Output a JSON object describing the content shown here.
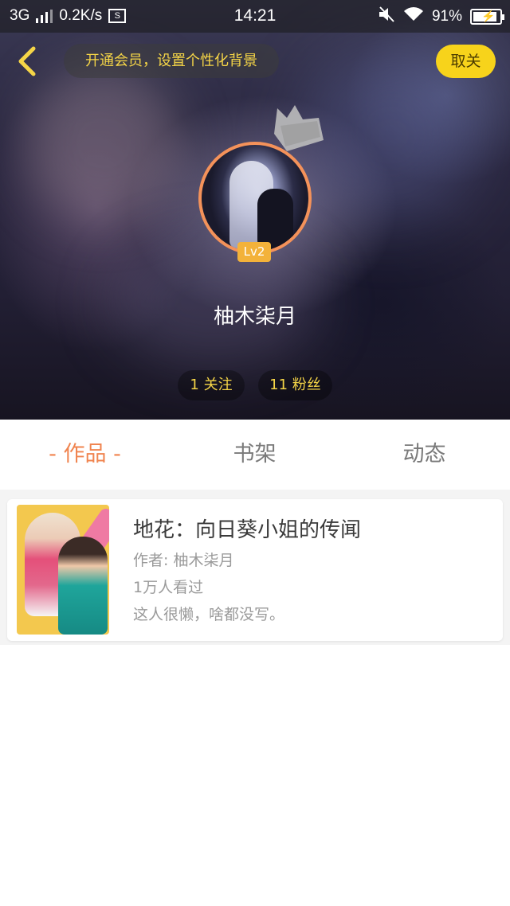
{
  "status_bar": {
    "network": "3G",
    "speed": "0.2K/s",
    "network_icon_label": "S",
    "time": "14:21",
    "battery": "91%",
    "battery_level": 0.91,
    "icons": [
      "signal-icon",
      "screenshot-icon",
      "mute-icon",
      "wifi-icon",
      "battery-icon"
    ]
  },
  "header": {
    "vip_banner": "开通会员，设置个性化背景",
    "unfollow_label": "取关",
    "level_badge": "Lv2",
    "username": "柚木柒月",
    "following": "1 关注",
    "followers": "11 粉丝",
    "accent_color": "#f7d31b"
  },
  "tabs": [
    {
      "label": "- 作品 -",
      "active": true
    },
    {
      "label": "书架",
      "active": false
    },
    {
      "label": "动态",
      "active": false
    }
  ],
  "works": [
    {
      "title": "地花：向日葵小姐的传闻",
      "author": "作者: 柚木柒月",
      "views": "1万人看过",
      "description": "这人很懒，啥都没写。"
    }
  ],
  "colors": {
    "tab_active": "#f0844f",
    "avatar_border": "#f4925a",
    "badge": "#f3b23a"
  }
}
